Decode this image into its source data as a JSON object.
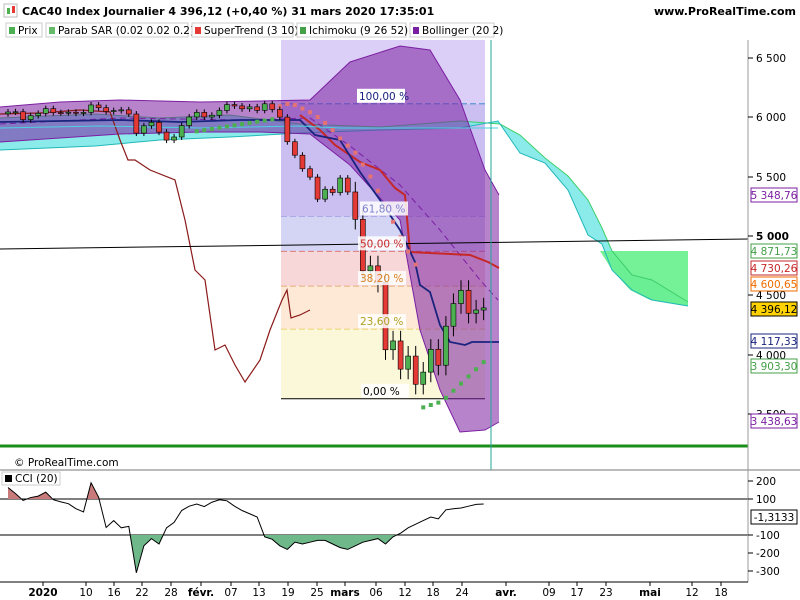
{
  "header": {
    "title": "CAC40 Index Journalier 4 396,12 (+0,40 %) 31 mars 2020 17:35:01",
    "site": "www.ProRealTime.com"
  },
  "legend": [
    {
      "label": "Prix",
      "color": "#4caf50"
    },
    {
      "label": "Parab SAR (0.02 0.02 0.2)",
      "color": "#66bb6a"
    },
    {
      "label": "SuperTrend (3 10)",
      "color": "#e53935"
    },
    {
      "label": "Ichimoku (9 26 52)",
      "color": "#43a047"
    },
    {
      "label": "Bollinger (20 2)",
      "color": "#7b1fa2"
    }
  ],
  "watermark": "© ProRealTime.com",
  "cci_label": "CCI (20)",
  "fib_labels": [
    "100,00 %",
    "61,80 %",
    "50,00 %",
    "38,20 %",
    "23,60 %",
    "0,00 %"
  ],
  "price_axis": {
    "ticks": [
      "6 500",
      "6 000",
      "5 500",
      "5 000",
      "4 500",
      "4 000",
      "3 500"
    ],
    "tags": [
      {
        "text": "5 348,76",
        "color": "#7b1fa2",
        "bg": "#ffffff"
      },
      {
        "text": "4 871,73",
        "color": "#43a047",
        "bg": "#ffffff"
      },
      {
        "text": "4 730,26",
        "color": "#c62828",
        "bg": "#ffffff"
      },
      {
        "text": "4 600,65",
        "color": "#ef6c00",
        "bg": "#ffffff"
      },
      {
        "text": "4 396,12",
        "color": "#000000",
        "bg": "#ffd200"
      },
      {
        "text": "4 117,33",
        "color": "#1a237e",
        "bg": "#ffffff"
      },
      {
        "text": "3 903,30",
        "color": "#43a047",
        "bg": "#ffffff"
      },
      {
        "text": "3 438,63",
        "color": "#7b1fa2",
        "bg": "#ffffff"
      }
    ]
  },
  "cci_axis": {
    "ticks": [
      "200",
      "100",
      "-100",
      "-200",
      "-300"
    ],
    "tag": "-1,3133"
  },
  "date_axis": [
    "2020",
    "10",
    "16",
    "22",
    "28",
    "févr.",
    "07",
    "13",
    "19",
    "25",
    "mars",
    "06",
    "12",
    "18",
    "24",
    "avr.",
    "09",
    "17",
    "23",
    "mai",
    "12",
    "18"
  ],
  "colors": {
    "bollinger": "#7b1fa2",
    "supertrend": "#c62828",
    "kijun": "#1a237e",
    "chikou": "#8b1a1a",
    "cloud": "#7ee8e8",
    "cloud_green": "#66f08c",
    "up": "#4caf50",
    "down": "#e53935",
    "sar": "#4caf50"
  },
  "chart_data": {
    "type": "candlestick",
    "instrument": "CAC40",
    "timeframe": "Journalier",
    "last_price": 4396.12,
    "change_pct": 0.4,
    "price_ylim": [
      3300,
      6750
    ],
    "cci_ylim": [
      -340,
      260
    ],
    "dates": [
      "2020-01-02",
      "2020-01-03",
      "2020-01-06",
      "2020-01-07",
      "2020-01-08",
      "2020-01-09",
      "2020-01-10",
      "2020-01-13",
      "2020-01-14",
      "2020-01-15",
      "2020-01-16",
      "2020-01-17",
      "2020-01-20",
      "2020-01-21",
      "2020-01-22",
      "2020-01-23",
      "2020-01-24",
      "2020-01-27",
      "2020-01-28",
      "2020-01-29",
      "2020-01-30",
      "2020-01-31",
      "2020-02-03",
      "2020-02-04",
      "2020-02-05",
      "2020-02-06",
      "2020-02-07",
      "2020-02-10",
      "2020-02-11",
      "2020-02-12",
      "2020-02-13",
      "2020-02-14",
      "2020-02-17",
      "2020-02-18",
      "2020-02-19",
      "2020-02-20",
      "2020-02-21",
      "2020-02-24",
      "2020-02-25",
      "2020-02-26",
      "2020-02-27",
      "2020-02-28",
      "2020-03-02",
      "2020-03-03",
      "2020-03-04",
      "2020-03-05",
      "2020-03-06",
      "2020-03-09",
      "2020-03-10",
      "2020-03-11",
      "2020-03-12",
      "2020-03-13",
      "2020-03-16",
      "2020-03-17",
      "2020-03-18",
      "2020-03-19",
      "2020-03-20",
      "2020-03-23",
      "2020-03-24",
      "2020-03-25",
      "2020-03-26",
      "2020-03-27",
      "2020-03-30",
      "2020-03-31"
    ],
    "close": [
      6042,
      6044,
      5978,
      6012,
      6031,
      6070,
      6037,
      6036,
      6040,
      6032,
      6039,
      6101,
      6078,
      6046,
      6054,
      6060,
      6025,
      5865,
      5926,
      5955,
      5873,
      5806,
      5832,
      5928,
      6000,
      6039,
      6000,
      6015,
      6055,
      6104,
      6093,
      6069,
      6085,
      6056,
      6111,
      6063,
      5999,
      5792,
      5679,
      5565,
      5495,
      5310,
      5393,
      5365,
      5487,
      5370,
      5140,
      4707,
      4749,
      4611,
      4044,
      4118,
      3881,
      3991,
      3754,
      3856,
      4048,
      3914,
      4242,
      4432,
      4543,
      4351,
      4378,
      4396
    ],
    "sar": [
      5950,
      5955,
      5960,
      5965,
      5970,
      5975,
      5980,
      5985,
      5990,
      5995,
      6000,
      6100,
      6110,
      6115,
      6120,
      6125,
      6130,
      6135,
      6140,
      5960,
      5880,
      5860,
      5870,
      5875,
      5880,
      5890,
      5900,
      5905,
      5910,
      5920,
      5930,
      5940,
      5950,
      5960,
      5970,
      5980,
      6090,
      6110,
      6100,
      6070,
      6040,
      6000,
      5950,
      5890,
      5820,
      5760,
      5700,
      5600,
      5500,
      5380,
      5250,
      5120,
      4990,
      4870,
      4760,
      3560,
      3580,
      3600,
      3640,
      3700,
      3760,
      3820,
      3880,
      3940
    ],
    "cci": [
      164,
      130,
      92,
      108,
      116,
      138,
      96,
      84,
      74,
      46,
      28,
      190,
      110,
      -58,
      -20,
      -60,
      -52,
      -310,
      -160,
      -120,
      -150,
      -60,
      -30,
      36,
      60,
      72,
      58,
      82,
      96,
      90,
      60,
      36,
      18,
      0,
      -110,
      -124,
      -160,
      -180,
      -140,
      -150,
      -140,
      -130,
      -130,
      -150,
      -170,
      -180,
      -160,
      -140,
      -130,
      -120,
      -150,
      -110,
      -90,
      -60,
      -40,
      -20,
      0,
      -10,
      40,
      46,
      50,
      60,
      70,
      72
    ],
    "fibonacci": {
      "high": 6111,
      "low": 3632,
      "levels": [
        1.0,
        0.618,
        0.5,
        0.382,
        0.236,
        0.0
      ]
    }
  }
}
